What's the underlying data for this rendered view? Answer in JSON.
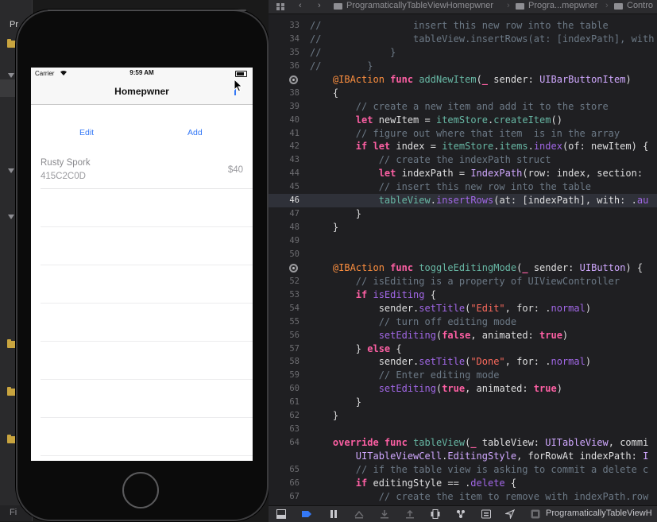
{
  "navigator": {
    "project_label": "Pr",
    "filter_label": "Fi"
  },
  "simulator": {
    "status_bar": {
      "carrier": "Carrier",
      "time": "9:59 AM"
    },
    "nav_title": "Homepwner",
    "header": {
      "edit_label": "Edit",
      "add_label": "Add"
    },
    "items": [
      {
        "name": "Rusty Spork",
        "serial": "415C2C0D",
        "value": "$40"
      }
    ],
    "empty_rows": 7
  },
  "editor": {
    "jump_bar": {
      "crumb_1": "ProgramaticallyTableViewHomepwner",
      "crumb_2": "Progra...mepwner",
      "crumb_3": "Contro"
    },
    "current_line": 46,
    "lines": [
      {
        "n": "33",
        "html": "<span class=\"cm\">//                insert this new row into the table</span>"
      },
      {
        "n": "34",
        "html": "<span class=\"cm\">//                tableView.insertRows(at: [indexPath], with</span>"
      },
      {
        "n": "35",
        "html": "<span class=\"cm\">//            }</span>"
      },
      {
        "n": "36",
        "html": "<span class=\"cm\">//        }</span>"
      },
      {
        "n": "37",
        "bp": true,
        "html": "    <span class=\"at\">@IBAction</span> <span class=\"kw\">func</span> <span class=\"fn\">addNewItem</span>(<span class=\"kw\">_</span> sender: <span class=\"tp\">UIBarButtonItem</span>)"
      },
      {
        "n": "38",
        "html": "    {"
      },
      {
        "n": "39",
        "html": "        <span class=\"cm\">// create a new item and add it to the store</span>"
      },
      {
        "n": "40",
        "html": "        <span class=\"kw\">let</span> newItem = <span class=\"fn\">itemStore</span>.<span class=\"fn\">createItem</span>()"
      },
      {
        "n": "41",
        "html": "        <span class=\"cm\">// figure out where that item  is in the array</span>"
      },
      {
        "n": "42",
        "html": "        <span class=\"kw\">if let</span> index = <span class=\"fn\">itemStore</span>.<span class=\"fn\">items</span>.<span class=\"pr\">index</span>(of: newItem) {"
      },
      {
        "n": "43",
        "html": "            <span class=\"cm\">// create the indexPath struct</span>"
      },
      {
        "n": "44",
        "html": "            <span class=\"kw\">let</span> indexPath = <span class=\"tp\">IndexPath</span>(row: index, section:"
      },
      {
        "n": "45",
        "html": "            <span class=\"cm\">// insert this new row into the table</span>"
      },
      {
        "n": "46",
        "html": "            <span class=\"fn\">tableView</span>.<span class=\"pr\">insertRows</span>(at: [indexPath], with: .<span class=\"pr\">au</span>"
      },
      {
        "n": "47",
        "html": "        }"
      },
      {
        "n": "48",
        "html": "    }"
      },
      {
        "n": "49",
        "html": ""
      },
      {
        "n": "50",
        "html": ""
      },
      {
        "n": "51",
        "bp": true,
        "html": "    <span class=\"at\">@IBAction</span> <span class=\"kw\">func</span> <span class=\"fn\">toggleEditingMode</span>(<span class=\"kw\">_</span> sender: <span class=\"tp\">UIButton</span>) {"
      },
      {
        "n": "52",
        "html": "        <span class=\"cm\">// isEditing is a property of UIViewController</span>"
      },
      {
        "n": "53",
        "html": "        <span class=\"kw\">if</span> <span class=\"pr\">isEditing</span> {"
      },
      {
        "n": "54",
        "html": "            sender.<span class=\"pr\">setTitle</span>(<span class=\"st\">\"Edit\"</span>, for: .<span class=\"pr\">normal</span>)"
      },
      {
        "n": "55",
        "html": "            <span class=\"cm\">// turn off editing mode</span>"
      },
      {
        "n": "56",
        "html": "            <span class=\"pr\">setEditing</span>(<span class=\"kw\">false</span>, animated: <span class=\"kw\">true</span>)"
      },
      {
        "n": "57",
        "html": "        } <span class=\"kw\">else</span> {"
      },
      {
        "n": "58",
        "html": "            sender.<span class=\"pr\">setTitle</span>(<span class=\"st\">\"Done\"</span>, for: .<span class=\"pr\">normal</span>)"
      },
      {
        "n": "59",
        "html": "            <span class=\"cm\">// Enter editing mode</span>"
      },
      {
        "n": "60",
        "html": "            <span class=\"pr\">setEditing</span>(<span class=\"kw\">true</span>, animated: <span class=\"kw\">true</span>)"
      },
      {
        "n": "61",
        "html": "        }"
      },
      {
        "n": "62",
        "html": "    }"
      },
      {
        "n": "63",
        "html": ""
      },
      {
        "n": "64",
        "html": "    <span class=\"kw\">override func</span> <span class=\"fn\">tableView</span>(<span class=\"kw\">_</span> tableView: <span class=\"tp\">UITableView</span>, commi"
      },
      {
        "n": "",
        "html": "        <span class=\"tp\">UITableViewCell</span>.<span class=\"tp\">EditingStyle</span>, forRowAt indexPath: <span class=\"tp\">I</span>"
      },
      {
        "n": "65",
        "html": "        <span class=\"cm\">// if the table view is asking to commit a delete c</span>"
      },
      {
        "n": "66",
        "html": "        <span class=\"kw\">if</span> editingStyle == .<span class=\"pr\">delete</span> {"
      },
      {
        "n": "67",
        "html": "            <span class=\"cm\">// create the item to remove with indexPath.row</span>"
      }
    ],
    "debug_bar": {
      "scheme_label": "ProgramaticallyTableViewH"
    }
  },
  "colors": {
    "accent": "#3478f6",
    "editor_bg": "#1f1f22",
    "keyword": "#fc5fa3",
    "comment": "#6c7986",
    "type": "#d0a8ff",
    "string": "#fc6a5d"
  }
}
